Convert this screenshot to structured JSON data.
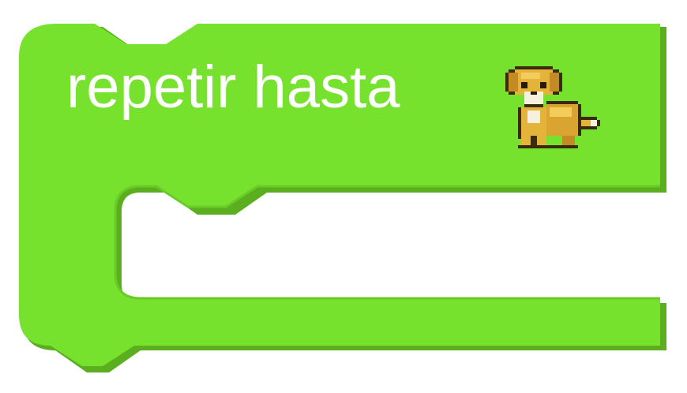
{
  "block": {
    "label": "repetir hasta",
    "condition_icon": "dog-sprite-icon",
    "fill_color": "#76E22E",
    "shadow_color": "#5BAF1F",
    "text_color": "#FFFFFF"
  }
}
